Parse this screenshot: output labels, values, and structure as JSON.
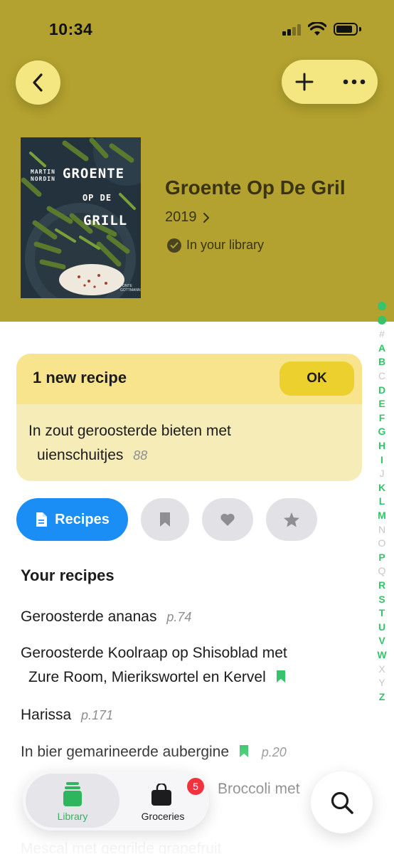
{
  "status_bar": {
    "time": "10:34"
  },
  "header": {
    "background_color": "#b3a22f",
    "button_color": "#f4e681"
  },
  "book": {
    "title": "Groente Op De Gril",
    "year": "2019",
    "library_status": "In your library",
    "cover": {
      "author_line1": "MARTIN",
      "author_line2": "NORDIN",
      "title_line1": "GROENTE",
      "title_line2": "OP DE",
      "title_line3": "GRILL",
      "publisher_line1": "FONTE",
      "publisher_line2": "GOTTMANN"
    }
  },
  "new_recipes": {
    "title": "1 new recipe",
    "ok_label": "OK",
    "recipe": {
      "name_line1": "In zout geroosterde bieten met",
      "name_line2": "uienschuitjes",
      "page": "88"
    }
  },
  "filters": {
    "recipes_label": "Recipes",
    "active_color": "#1a8ef5"
  },
  "section_title": "Your recipes",
  "recipes": [
    {
      "name": "Geroosterde ananas",
      "page": "p.74"
    },
    {
      "name_line1": "Geroosterde Koolraap op Shisoblad met",
      "name_line2": "Zure Room, Mierikswortel en Kervel",
      "bookmarked": true
    },
    {
      "name": "Harissa",
      "page": "p.171"
    },
    {
      "name": "In bier gemarineerde aubergine",
      "page": "p.20",
      "bookmarked": true
    },
    {
      "name_partial": "Broccoli met"
    },
    {
      "name": "Mescal met gegrilde grapefruit"
    }
  ],
  "index": {
    "letters": [
      "#",
      "A",
      "B",
      "C",
      "D",
      "E",
      "F",
      "G",
      "H",
      "I",
      "J",
      "K",
      "L",
      "M",
      "N",
      "O",
      "P",
      "Q",
      "R",
      "S",
      "T",
      "U",
      "V",
      "W",
      "X",
      "Y",
      "Z"
    ],
    "active_color": "#35c46a",
    "inactive_color": "#c7c7cc"
  },
  "tab_bar": {
    "library_label": "Library",
    "groceries_label": "Groceries",
    "groceries_badge": "5",
    "accent_color": "#2fb55d"
  }
}
